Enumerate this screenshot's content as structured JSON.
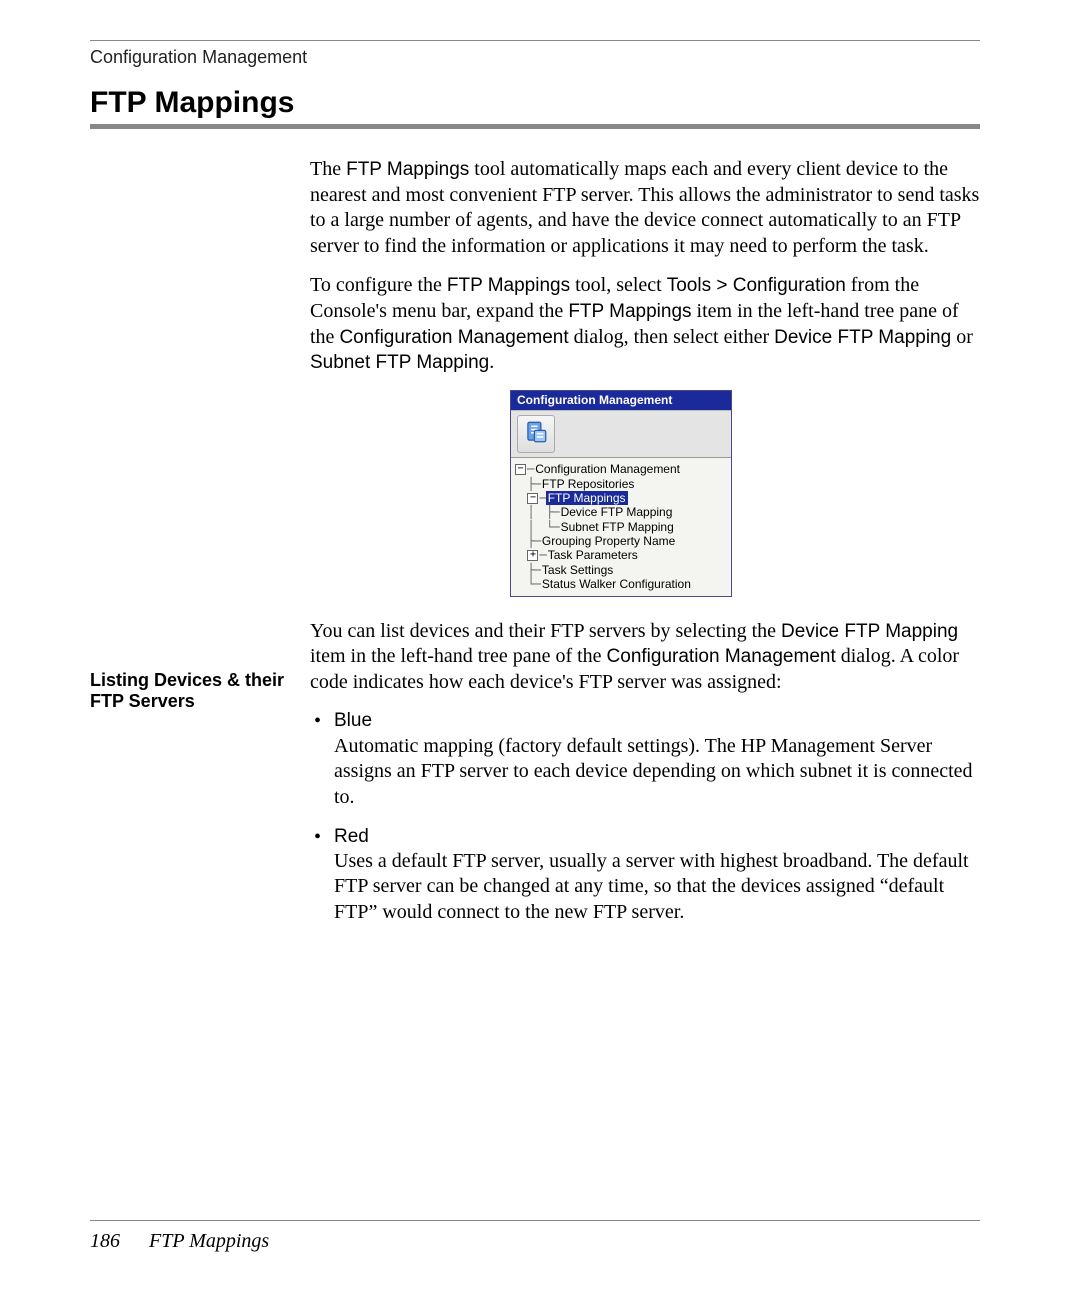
{
  "running_head": "Configuration Management",
  "section_title": "FTP Mappings",
  "para1": {
    "pre": "The ",
    "tool": "FTP Mappings",
    "post": " tool automatically maps each and every client device to the nearest and most convenient FTP server. This allows the administrator to send tasks to a large number of agents, and have the device connect automatically to an FTP server to find the information or applications it may need to perform the task."
  },
  "para2": {
    "a": "To configure the ",
    "b": "FTP Mappings",
    "c": " tool, select ",
    "d": "Tools > Configuration",
    "e": " from the Console's menu bar, expand the ",
    "f": "FTP Mappings",
    "g": " item in the left-hand tree pane of the ",
    "h": "Configuration Management",
    "i": " dialog, then select either ",
    "j": "Device FTP Mapping",
    "k": " or ",
    "l": "Subnet FTP Mapping",
    "m": "."
  },
  "panel": {
    "title": "Configuration Management",
    "tree": {
      "root": "Configuration Management",
      "n1": "FTP Repositories",
      "n2": "FTP Mappings",
      "n2a": "Device FTP Mapping",
      "n2b": "Subnet FTP Mapping",
      "n3": "Grouping Property Name",
      "n4": "Task Parameters",
      "n5": "Task Settings",
      "n6": "Status Walker Configuration"
    }
  },
  "side_heading": "Listing Devices & their FTP Servers",
  "para3": {
    "a": "You can list devices and their FTP servers by selecting the ",
    "b": "Device FTP Mapping",
    "c": " item in the left-hand tree pane of the ",
    "d": "Configuration Management",
    "e": " dialog. A color code indicates how each device's FTP server was assigned:"
  },
  "bullets": [
    {
      "label": "Blue",
      "body": "Automatic mapping (factory default settings). The HP Management Server assigns an FTP server to each device depending on which subnet it is connected to."
    },
    {
      "label": "Red",
      "body": "Uses a default FTP server, usually a server with highest broadband. The default FTP server can be changed at any time, so that the devices assigned “default FTP” would connect to the new FTP server."
    }
  ],
  "footer": {
    "page": "186",
    "title": "FTP Mappings"
  }
}
